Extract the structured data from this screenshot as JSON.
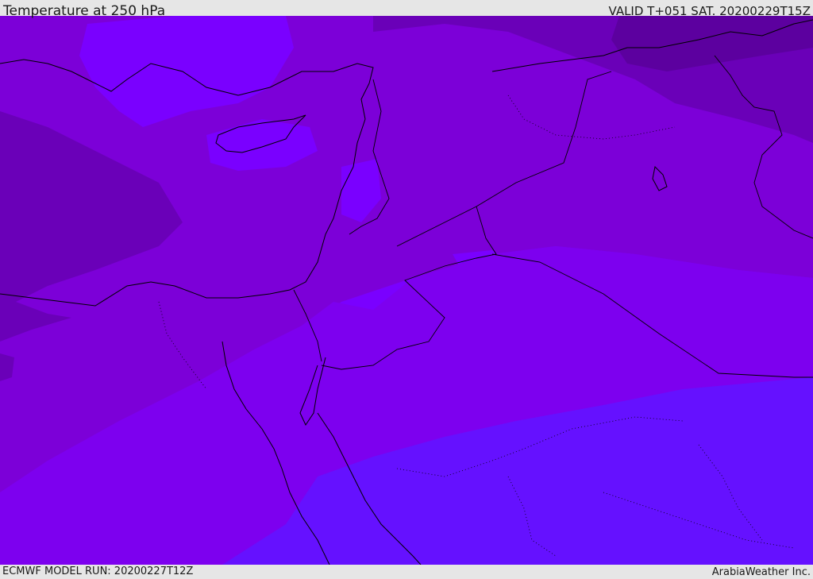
{
  "header": {
    "title": "Temperature at 250 hPa",
    "valid": "VALID T+051 SAT. 20200229T15Z"
  },
  "footer": {
    "model_run": "ECMWF MODEL RUN: 20200227T12Z",
    "credit": "ArabiaWeather Inc."
  },
  "colors": {
    "band_warmest": "#6511ff",
    "band_warm": "#7a00ff",
    "band_mid": "#7d00ef",
    "band_cool": "#7c00d8",
    "band_colder": "#6a00b8",
    "band_coldest": "#5c009f",
    "coastline": "#000000",
    "border": "#000000"
  }
}
